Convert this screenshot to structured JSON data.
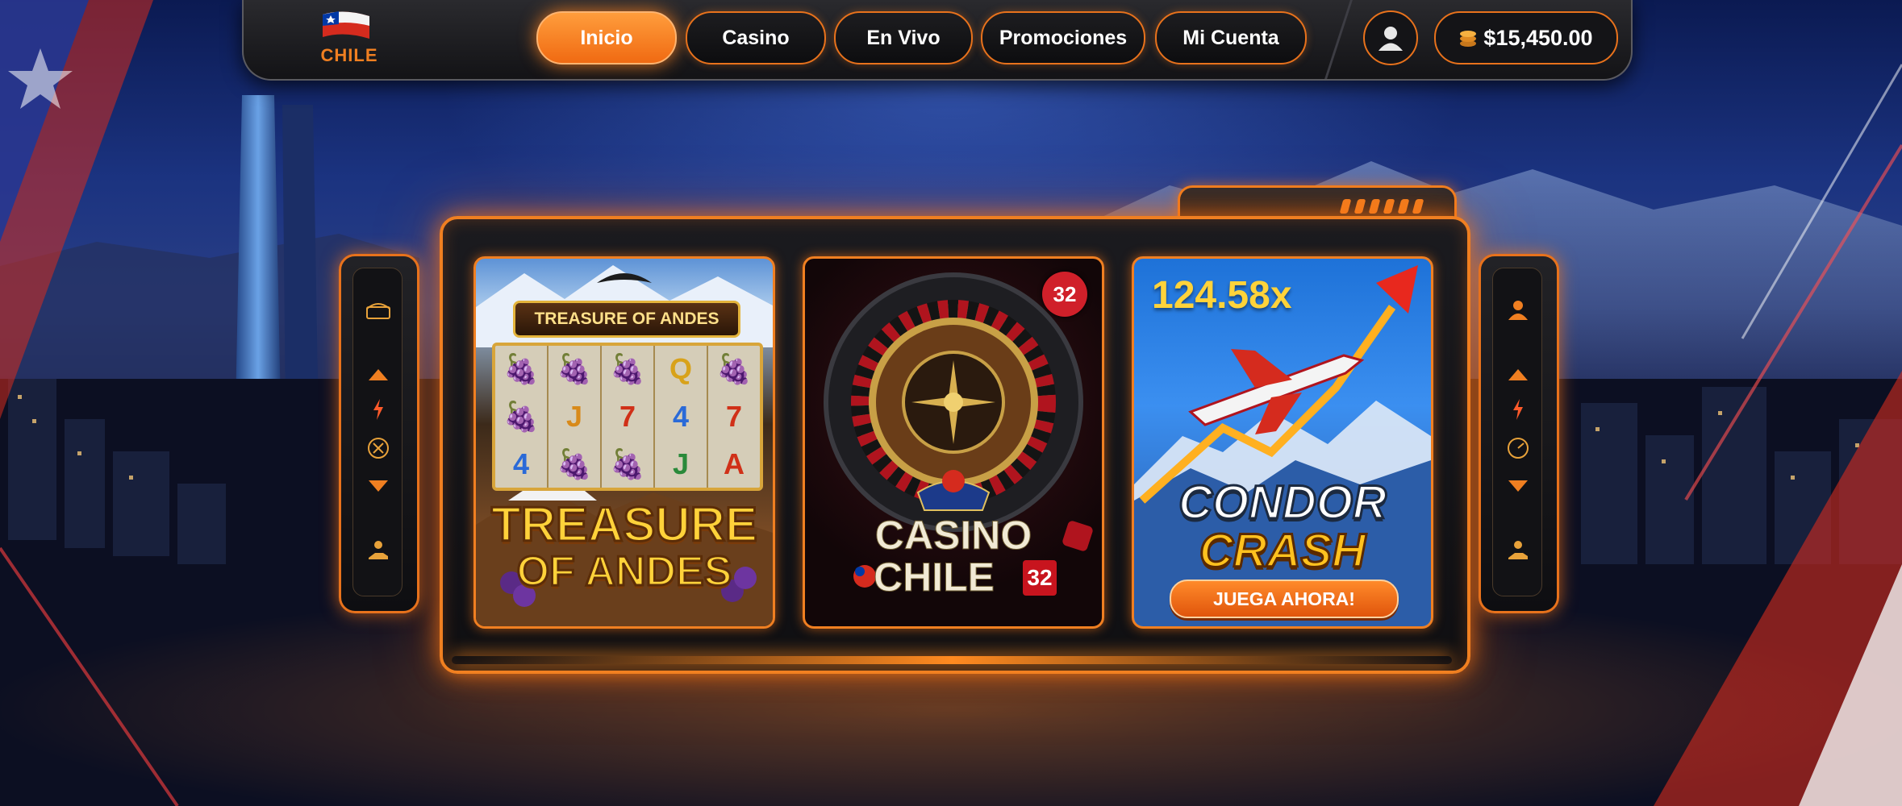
{
  "brand": {
    "logo_text": "CHILE"
  },
  "nav": {
    "items": [
      {
        "label": "Inicio",
        "active": true
      },
      {
        "label": "Casino",
        "active": false
      },
      {
        "label": "En Vivo",
        "active": false
      },
      {
        "label": "Promociones",
        "active": false
      },
      {
        "label": "Mi Cuenta",
        "active": false
      }
    ]
  },
  "account": {
    "avatar_icon": "user-icon",
    "balance": "$15,450.00",
    "balance_icon": "coin-stack-icon"
  },
  "side_panels": {
    "left_icons": [
      "treasure-chest-icon",
      "arrow-up-icon",
      "lightning-icon",
      "dice-icon",
      "arrow-down-icon",
      "hand-coin-icon"
    ],
    "right_icons": [
      "user-icon",
      "arrow-up-icon",
      "lightning-icon",
      "speedometer-icon",
      "arrow-down-icon",
      "hand-coin-icon"
    ]
  },
  "games": {
    "andes": {
      "banner": "TREASURE OF ANDES",
      "title_line1": "TREASURE",
      "title_line2": "OF ANDES",
      "reel_symbols": [
        [
          "🍇",
          "🍇",
          "4"
        ],
        [
          "🍇",
          "J",
          "🍇"
        ],
        [
          "🍇",
          "7",
          "🍇"
        ],
        [
          "Q",
          "4",
          "J"
        ],
        [
          "🍇",
          "7",
          "A"
        ]
      ]
    },
    "roulette": {
      "badge": "32",
      "title_line1": "CASINO",
      "title_line2": "CHILE",
      "title_number": "32"
    },
    "crash": {
      "multiplier": "124.58x",
      "title_line1": "CONDOR",
      "title_line2": "CRASH",
      "cta": "JUEGA AHORA!"
    }
  },
  "colors": {
    "accent": "#f07f21",
    "accent_glow": "#ff8a20",
    "flag_red": "#d52b1e",
    "flag_blue": "#0039a6"
  }
}
